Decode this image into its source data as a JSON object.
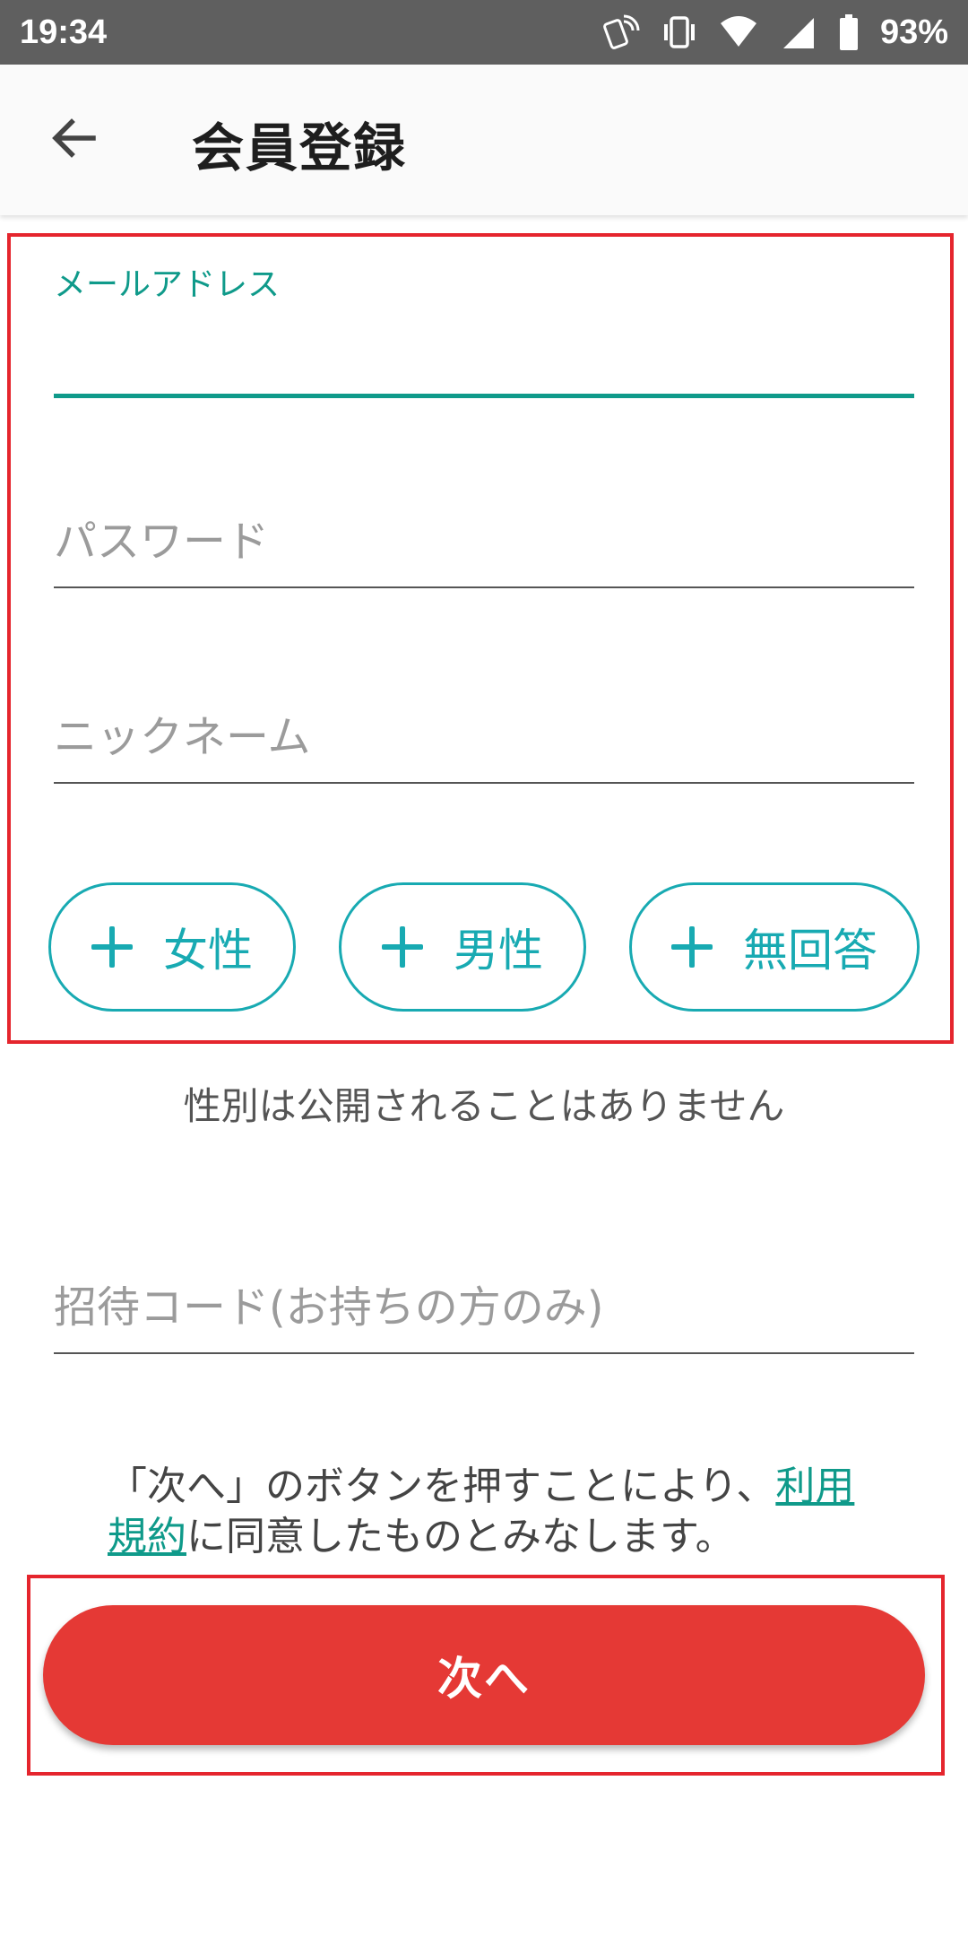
{
  "status_bar": {
    "time": "19:34",
    "battery": "93%",
    "icons": [
      "nfc-phone-icon",
      "vibrate-icon",
      "wifi-icon",
      "signal-icon",
      "battery-icon"
    ]
  },
  "app_bar": {
    "title": "会員登録",
    "back_icon": "arrow-back-icon"
  },
  "form": {
    "email": {
      "label": "メールアドレス",
      "value": ""
    },
    "password": {
      "placeholder": "パスワード",
      "value": ""
    },
    "nickname": {
      "placeholder": "ニックネーム",
      "value": ""
    },
    "gender_options": [
      {
        "label": "女性",
        "icon": "plus-icon"
      },
      {
        "label": "男性",
        "icon": "plus-icon"
      },
      {
        "label": "無回答",
        "icon": "plus-icon"
      }
    ],
    "gender_note": "性別は公開されることはありません",
    "invite_code": {
      "placeholder": "招待コード(お持ちの方のみ)",
      "value": ""
    }
  },
  "terms": {
    "prefix": "「次へ」のボタンを押すことにより、",
    "link": "利用規約",
    "suffix": "に同意したものとみなします。"
  },
  "next_button": {
    "label": "次へ"
  },
  "colors": {
    "accent": "#0f9a8a",
    "gender_outline": "#18aab2",
    "primary_button": "#e53935",
    "highlight": "#e5252d"
  }
}
